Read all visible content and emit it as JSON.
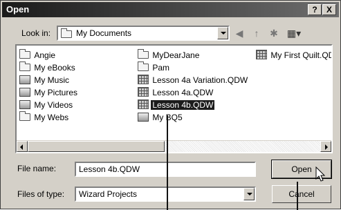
{
  "window": {
    "title": "Open",
    "help_glyph": "?",
    "close_glyph": "X"
  },
  "look_in": {
    "label": "Look in:",
    "value": "My Documents"
  },
  "toolbar_icons": [
    "back-icon",
    "up-folder-icon",
    "new-folder-icon",
    "view-menu-icon"
  ],
  "files": {
    "col1": [
      {
        "label": "Angie",
        "icon": "folder-icon"
      },
      {
        "label": "My eBooks",
        "icon": "folder-icon"
      },
      {
        "label": "My Music",
        "icon": "music-folder-icon"
      },
      {
        "label": "My Pictures",
        "icon": "pictures-folder-icon"
      },
      {
        "label": "My Videos",
        "icon": "videos-folder-icon"
      },
      {
        "label": "My Webs",
        "icon": "folder-icon"
      }
    ],
    "col2": [
      {
        "label": "MyDearJane",
        "icon": "folder-icon"
      },
      {
        "label": "Pam",
        "icon": "folder-icon"
      },
      {
        "label": "Lesson 4a Variation.QDW",
        "icon": "quilt-file-icon"
      },
      {
        "label": "Lesson 4a.QDW",
        "icon": "quilt-file-icon"
      },
      {
        "label": "Lesson 4b.QDW",
        "icon": "quilt-file-icon",
        "selected": true
      },
      {
        "label": "My BQ5",
        "icon": "shortcut-icon"
      }
    ],
    "col3": [
      {
        "label": "My First Quilt.QDW",
        "icon": "quilt-file-icon"
      }
    ]
  },
  "file_name": {
    "label": "File name:",
    "value": "Lesson 4b.QDW"
  },
  "files_of_type": {
    "label": "Files of type:",
    "value": "Wizard Projects"
  },
  "buttons": {
    "open": "Open",
    "cancel": "Cancel"
  }
}
